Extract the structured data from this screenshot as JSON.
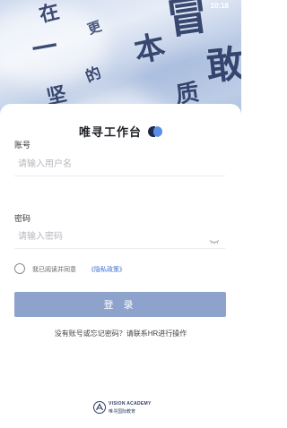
{
  "status_bar": {
    "time": "10:18"
  },
  "hero": {
    "strokes": [
      "在",
      "一",
      "敢",
      "坚",
      "更",
      "冒",
      "的",
      "本",
      "质"
    ]
  },
  "login": {
    "title": "唯寻工作台",
    "username_label": "账号",
    "username_placeholder": "请输入用户名",
    "password_label": "密码",
    "password_placeholder": "请输入密码",
    "agree_text": "我已阅读并同意",
    "privacy_link": "《隐私政策》",
    "login_button": "登 录",
    "help_text": "没有账号或忘记密码？请联系HR进行操作"
  },
  "footer": {
    "brand_en": "VISION ACADEMY",
    "brand_cn": "唯寻国际教育"
  },
  "icons": {
    "password_toggle": "eye-off-icon",
    "agree_radio": "radio-unchecked-icon",
    "brand_logo": "vision-academy-logo-icon"
  },
  "colors": {
    "accent": "#4a7ed8",
    "button_bg": "#8ea3cc",
    "badge_dark": "#1d2a48",
    "badge_light": "#5b8ee8",
    "link": "#3a6fd0"
  }
}
